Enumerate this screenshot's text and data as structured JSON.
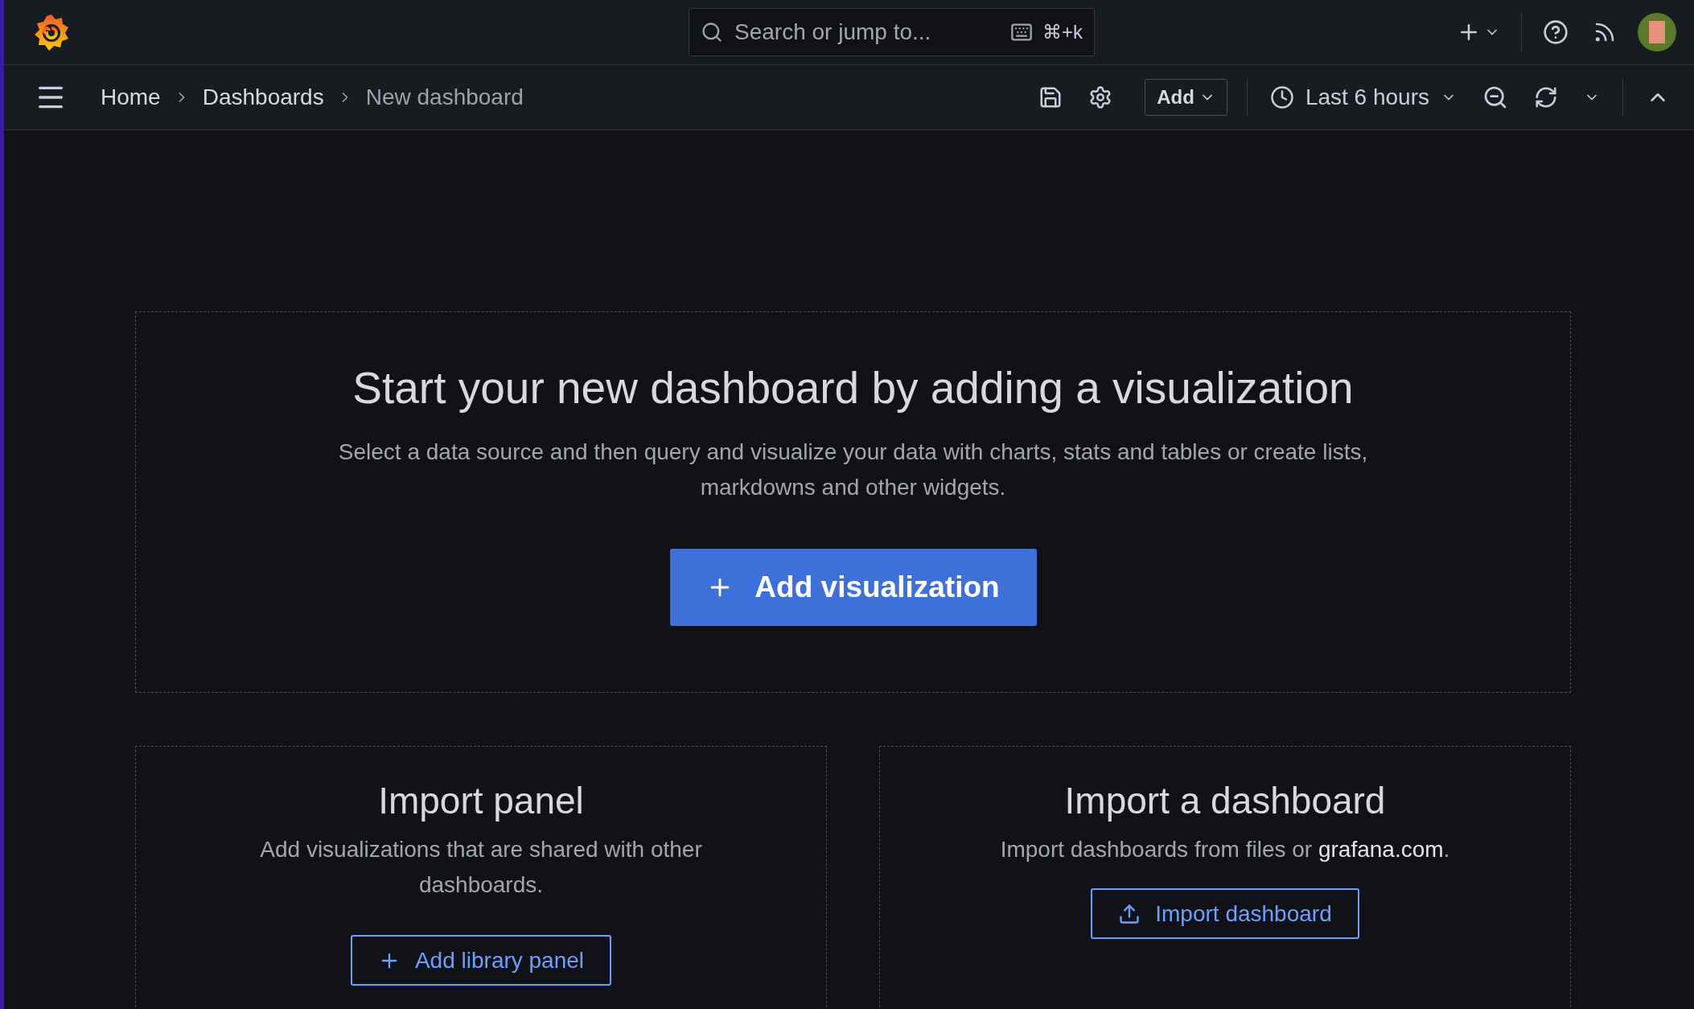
{
  "top_bar": {
    "search": {
      "placeholder": "Search or jump to...",
      "shortcut": "⌘+k"
    }
  },
  "nav_bar": {
    "breadcrumbs": [
      {
        "label": "Home",
        "current": false
      },
      {
        "label": "Dashboards",
        "current": false
      },
      {
        "label": "New dashboard",
        "current": true
      }
    ],
    "add_button": "Add",
    "time_range": "Last 6 hours"
  },
  "empty_state": {
    "title": "Start your new dashboard by adding a visualization",
    "description": "Select a data source and then query and visualize your data with charts, stats and tables or create lists, markdowns and other widgets.",
    "button": "Add visualization"
  },
  "import_panel": {
    "title": "Import panel",
    "description": "Add visualizations that are shared with other dashboards.",
    "button": "Add library panel"
  },
  "import_dashboard": {
    "title": "Import a dashboard",
    "description_before": "Import dashboards from files or ",
    "link": "grafana.com",
    "description_after": ".",
    "button": "Import dashboard"
  }
}
